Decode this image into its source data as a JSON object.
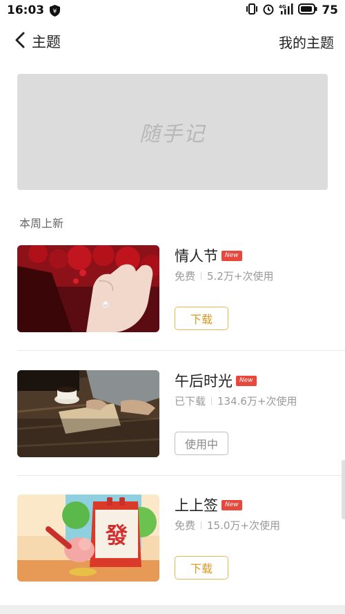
{
  "status_bar": {
    "time": "16:03",
    "battery": "75"
  },
  "nav": {
    "title": "主题",
    "my_themes": "我的主题"
  },
  "banner": {
    "logo_text": "随手记"
  },
  "section": {
    "title": "本周上新"
  },
  "themes": [
    {
      "name": "情人节",
      "badge": "New",
      "status": "免费",
      "uses": "5.2万+次使用",
      "button": "下载"
    },
    {
      "name": "午后时光",
      "badge": "New",
      "status": "已下载",
      "uses": "134.6万+次使用",
      "button": "使用中"
    },
    {
      "name": "上上签",
      "badge": "New",
      "status": "免费",
      "uses": "15.0万+次使用",
      "button": "下载"
    }
  ],
  "colors": {
    "accent": "#d99a20",
    "badge": "#e8473c",
    "banner_bg": "#dcdcdc"
  }
}
